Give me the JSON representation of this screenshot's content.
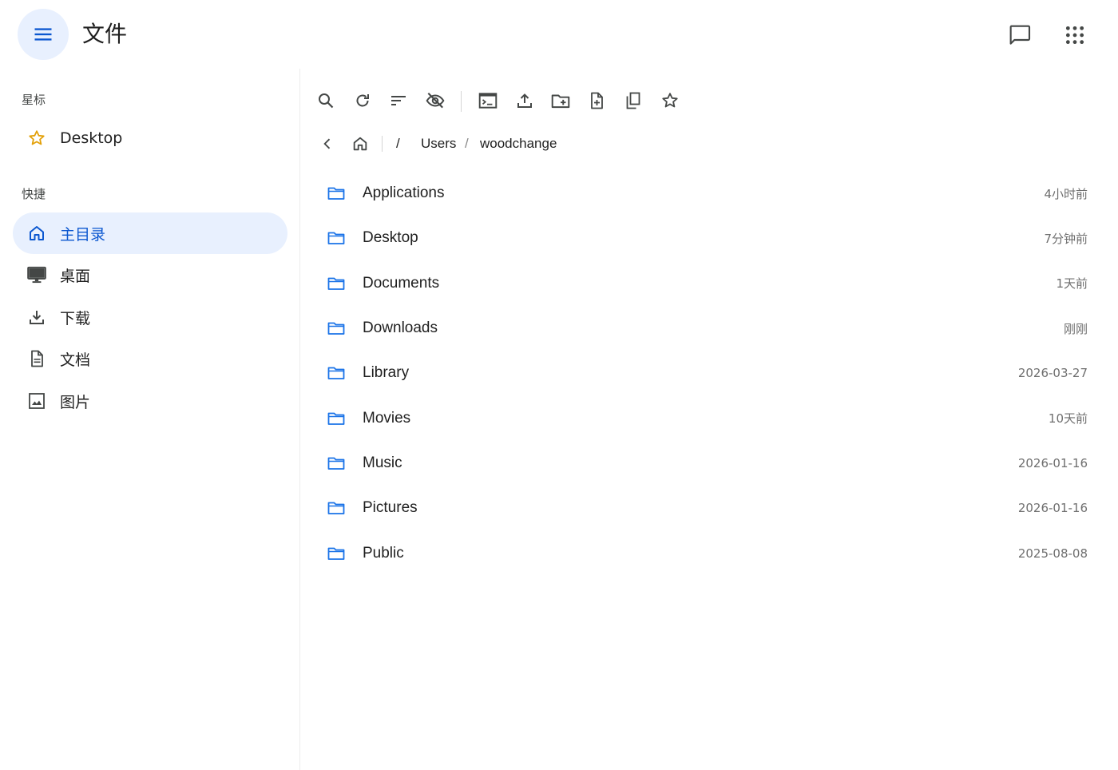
{
  "header": {
    "title": "文件",
    "menu_icon": "hamburger-menu-icon",
    "feedback_icon": "chat-feedback-icon",
    "apps_icon": "apps-grid-icon"
  },
  "sidebar": {
    "starred_label": "星标",
    "starred_items": [
      {
        "label": "Desktop",
        "icon": "star-icon"
      }
    ],
    "quick_label": "快捷",
    "quick_items": [
      {
        "label": "主目录",
        "icon": "home-icon",
        "active": true
      },
      {
        "label": "桌面",
        "icon": "desktop-monitor-icon"
      },
      {
        "label": "下载",
        "icon": "download-icon"
      },
      {
        "label": "文档",
        "icon": "document-icon"
      },
      {
        "label": "图片",
        "icon": "image-icon"
      }
    ]
  },
  "toolbar": [
    "search-icon",
    "refresh-icon",
    "sort-icon",
    "hide-hidden-files-icon",
    "terminal-icon",
    "upload-icon",
    "new-folder-icon",
    "new-file-icon",
    "copy-icon",
    "star-outline-icon"
  ],
  "breadcrumb": {
    "root": "/",
    "segments": [
      "Users",
      "woodchange"
    ],
    "separator": "/"
  },
  "files": [
    {
      "name": "Applications",
      "modified": "4小时前"
    },
    {
      "name": "Desktop",
      "modified": "7分钟前"
    },
    {
      "name": "Documents",
      "modified": "1天前"
    },
    {
      "name": "Downloads",
      "modified": "刚刚"
    },
    {
      "name": "Library",
      "modified": "2026-03-27"
    },
    {
      "name": "Movies",
      "modified": "10天前"
    },
    {
      "name": "Music",
      "modified": "2026-01-16"
    },
    {
      "name": "Pictures",
      "modified": "2026-01-16"
    },
    {
      "name": "Public",
      "modified": "2025-08-08"
    }
  ],
  "colors": {
    "accent": "#0b57d0",
    "active_bg": "#e8f0fe",
    "folder": "#1a73e8",
    "star": "#e3a008",
    "icon": "#444746"
  }
}
